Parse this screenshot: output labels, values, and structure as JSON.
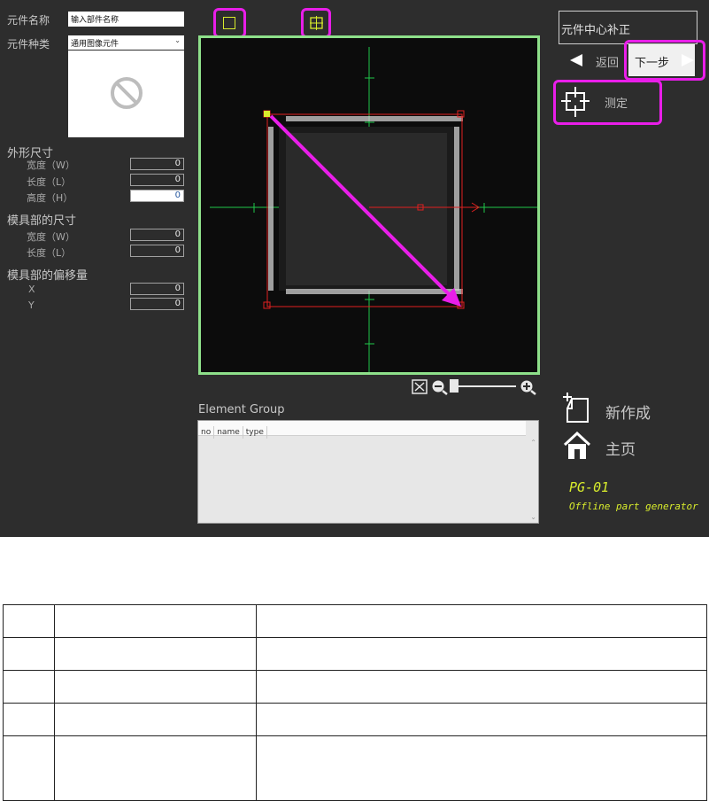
{
  "left_panel": {
    "part_name_label": "元件名称",
    "part_name_value": "输入部件名称",
    "part_type_label": "元件种类",
    "part_type_value": "通用图像元件",
    "outer_size": {
      "title": "外形尺寸",
      "width_label": "宽度（W）",
      "width_value": "0",
      "length_label": "长度（L）",
      "length_value": "0",
      "height_label": "高度（H）",
      "height_value": "0"
    },
    "mold_size": {
      "title": "模具部的尺寸",
      "width_label": "宽度（W）",
      "width_value": "0",
      "length_label": "长度（L）",
      "length_value": "0"
    },
    "mold_offset": {
      "title": "模具部的偏移量",
      "x_label": "X",
      "x_value": "0",
      "y_label": "Y",
      "y_value": "0"
    }
  },
  "right_panel": {
    "step_title": "元件中心补正",
    "back_label": "返回",
    "next_label": "下一步",
    "measure_label": "测定",
    "new_label": "新作成",
    "home_label": "主页",
    "app_code": "PG-01",
    "app_subtitle": "Offline part generator"
  },
  "element_group": {
    "title": "Element Group",
    "columns": [
      "no",
      "name",
      "type"
    ]
  },
  "colors": {
    "viewer_border": "#8ee08a",
    "highlight": "#e91ee9",
    "brand_yellow": "#d8ec2c",
    "crosshair": "#1fc84a",
    "outline_red": "#e02020"
  },
  "icons": [
    "rect-select-icon",
    "center-select-icon",
    "zoom-fit-icon",
    "zoom-out-icon",
    "zoom-in-icon",
    "back-arrow-icon",
    "next-arrow-icon",
    "measure-crosshair-icon",
    "new-document-icon",
    "home-icon",
    "no-image-icon",
    "dropdown-chevron-icon"
  ],
  "table": {
    "rows": 5,
    "cols": 3
  }
}
